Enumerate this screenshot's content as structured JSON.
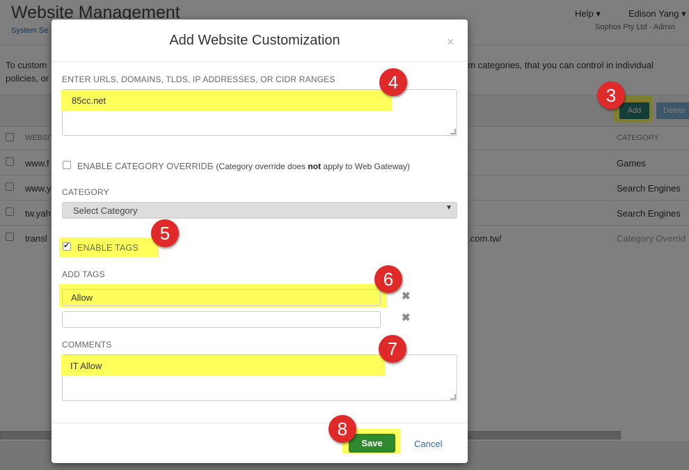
{
  "header": {
    "title": "Website Management",
    "breadcrumb": "System Se",
    "help": "Help ▾",
    "user": "Edison Yang ▾",
    "org": "Sophos Pty Ltd · Admin"
  },
  "intro": {
    "line1_left": "To custom",
    "line1_right": "om categories, that you can control in individual",
    "line2": "policies, or"
  },
  "toolbar": {
    "add_label": "Add",
    "delete_label": "Delete"
  },
  "grid": {
    "header_site": "WEBSITE",
    "header_category": "CATEGORY",
    "rows": [
      {
        "site": "www.f",
        "url": "",
        "category": "Games"
      },
      {
        "site": "www.y",
        "url": "",
        "category": "Search Engines"
      },
      {
        "site": "tw.yah",
        "url": "",
        "category": "Search Engines"
      },
      {
        "site": "transl",
        "url": "le.com.tw/",
        "category": "Category Overrid"
      }
    ]
  },
  "modal": {
    "title": "Add Website Customization",
    "close": "×",
    "urls_label": "ENTER URLS, DOMAINS, TLDS, IP ADDRESSES, OR CIDR RANGES",
    "urls_value": "85cc.net",
    "override_label": "ENABLE CATEGORY OVERRIDE",
    "override_checked": false,
    "override_note_pre": "- (Category override does ",
    "override_note_bold": "not",
    "override_note_post": " apply to Web Gateway)",
    "category_label": "CATEGORY",
    "category_selected": "Select Category",
    "enable_tags_label": "ENABLE TAGS",
    "enable_tags_checked": true,
    "add_tags_label": "ADD TAGS",
    "tags": [
      "Allow",
      ""
    ],
    "remove_tag": "✖",
    "comments_label": "COMMENTS",
    "comments_value": "IT Allow",
    "save_label": "Save",
    "cancel_label": "Cancel"
  },
  "markers": [
    "3",
    "4",
    "5",
    "6",
    "7",
    "8"
  ],
  "colors": {
    "highlight": "#ffff5c",
    "marker": "#e02a2a",
    "save": "#2f8a2f",
    "add": "#2a7a6e",
    "link": "#2a6db0"
  }
}
